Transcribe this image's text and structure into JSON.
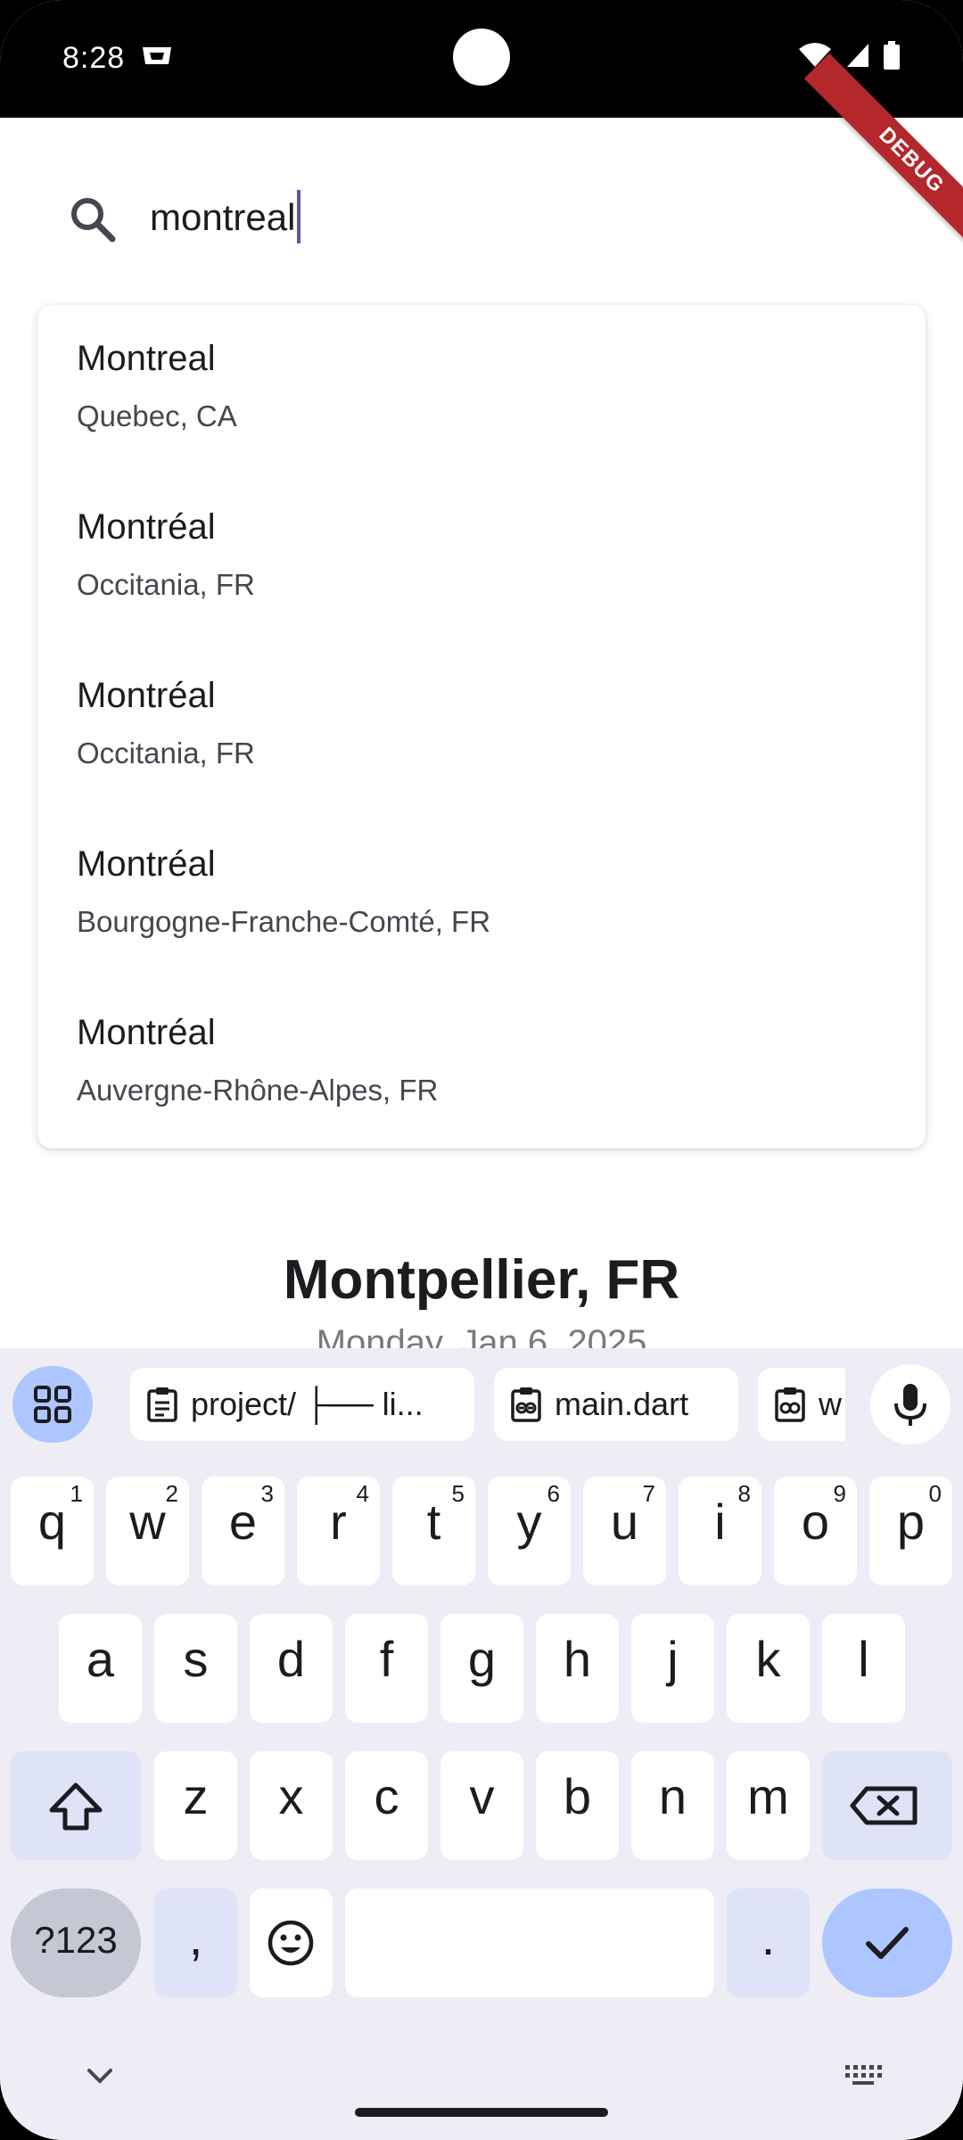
{
  "status_bar": {
    "time": "8:28"
  },
  "debug_banner": "DEBUG",
  "search": {
    "query": "montreal"
  },
  "suggestions": [
    {
      "name": "Montreal",
      "region": "Quebec, CA"
    },
    {
      "name": "Montréal",
      "region": "Occitania, FR"
    },
    {
      "name": "Montréal",
      "region": "Occitania, FR"
    },
    {
      "name": "Montréal",
      "region": "Bourgogne-Franche-Comté, FR"
    },
    {
      "name": "Montréal",
      "region": "Auvergne-Rhône-Alpes, FR"
    }
  ],
  "weather": {
    "city": "Montpellier, FR",
    "date": "Monday, Jan 6, 2025"
  },
  "keyboard": {
    "clipboard_chips": [
      "project/ ├── li...",
      "main.dart",
      "w"
    ],
    "row1": [
      {
        "ch": "q",
        "hint": "1"
      },
      {
        "ch": "w",
        "hint": "2"
      },
      {
        "ch": "e",
        "hint": "3"
      },
      {
        "ch": "r",
        "hint": "4"
      },
      {
        "ch": "t",
        "hint": "5"
      },
      {
        "ch": "y",
        "hint": "6"
      },
      {
        "ch": "u",
        "hint": "7"
      },
      {
        "ch": "i",
        "hint": "8"
      },
      {
        "ch": "o",
        "hint": "9"
      },
      {
        "ch": "p",
        "hint": "0"
      }
    ],
    "row2": [
      "a",
      "s",
      "d",
      "f",
      "g",
      "h",
      "j",
      "k",
      "l"
    ],
    "row3": [
      "z",
      "x",
      "c",
      "v",
      "b",
      "n",
      "m"
    ],
    "symbols_label": "?123",
    "comma": ",",
    "period": "."
  },
  "colors": {
    "accent": "#6750a4",
    "keyboard_accent": "#aec6ff",
    "debug_ribbon": "#b3272d"
  }
}
